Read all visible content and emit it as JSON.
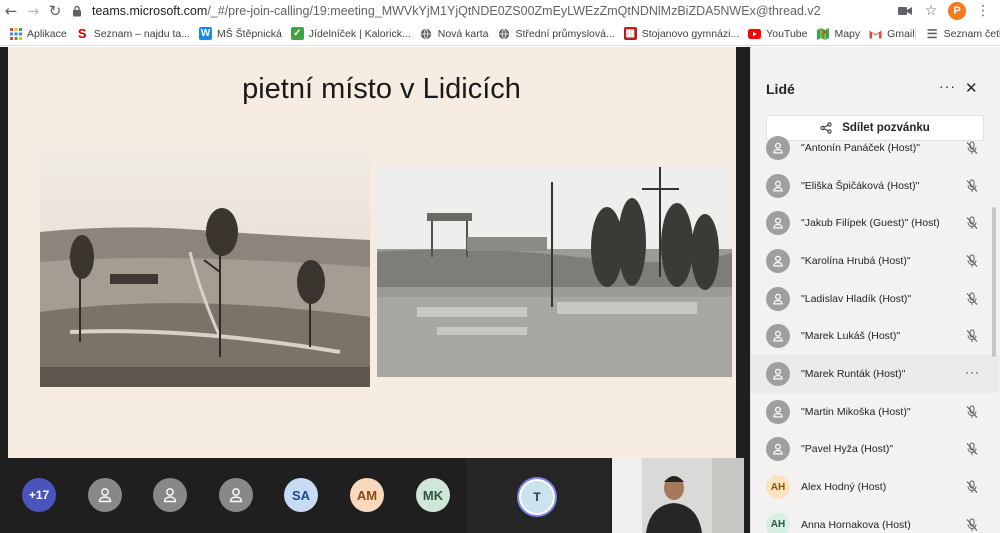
{
  "browser": {
    "url_host": "teams.microsoft.com",
    "url_path": "/_#/pre-join-calling/19:meeting_MWVkYjM1YjQtNDE0ZS00ZmEyLWEzZmQtNDNlMzBiZDA5NWEx@thread.v2",
    "profile_initial": "P",
    "bookmarks": [
      {
        "label": "Aplikace",
        "icon": "apps-grid-icon",
        "color": "#1a73e8"
      },
      {
        "label": "Seznam – najdu ta...",
        "icon": "seznam-icon",
        "color": "#cc0000"
      },
      {
        "label": "MŠ Štěpnická",
        "icon": "w-icon",
        "color": "#1e88e5"
      },
      {
        "label": "Jídelníček | Kalorick...",
        "icon": "check-icon",
        "color": "#43a047"
      },
      {
        "label": "Nová karta",
        "icon": "globe-icon",
        "color": "#5f6368"
      },
      {
        "label": "Střední průmyslová...",
        "icon": "globe-icon",
        "color": "#5f6368"
      },
      {
        "label": "Stojanovo gymnázi...",
        "icon": "school-icon",
        "color": "#d32f2f"
      },
      {
        "label": "YouTube",
        "icon": "youtube-icon",
        "color": "#ff0000"
      },
      {
        "label": "Mapy",
        "icon": "maps-icon",
        "color": "#34a853"
      },
      {
        "label": "Gmail",
        "icon": "gmail-icon",
        "color": "#ea4335"
      }
    ],
    "reading_list": "Seznam četby"
  },
  "slide": {
    "title": "pietní místo v Lidicích"
  },
  "strip": {
    "more_count": "+17",
    "initials": [
      "SA",
      "AM",
      "MK"
    ],
    "active_initial": "T"
  },
  "panel": {
    "title": "Lidé",
    "more": "···",
    "share_label": "Sdílet pozvánku",
    "participants": [
      {
        "name": "\"Antonín Panáček (Host)\"",
        "avatar": "person",
        "state": "muted"
      },
      {
        "name": "\"Eliška Špičáková (Host)\"",
        "avatar": "person",
        "state": "muted"
      },
      {
        "name": "\"Jakub Filípek (Guest)\" (Host)",
        "avatar": "person",
        "state": "muted"
      },
      {
        "name": "\"Karolína Hrubá (Host)\"",
        "avatar": "person",
        "state": "muted"
      },
      {
        "name": "\"Ladislav Hladík (Host)\"",
        "avatar": "person",
        "state": "muted"
      },
      {
        "name": "\"Marek Lukáš (Host)\"",
        "avatar": "person",
        "state": "muted"
      },
      {
        "name": "\"Marek Runták (Host)\"",
        "avatar": "person",
        "state": "hover"
      },
      {
        "name": "\"Martin Mikoška (Host)\"",
        "avatar": "person",
        "state": "muted"
      },
      {
        "name": "\"Pavel Hyža (Host)\"",
        "avatar": "person",
        "state": "muted"
      },
      {
        "name": "Alex Hodný (Host)",
        "avatar": "AH",
        "state": "muted"
      },
      {
        "name": "Anna Hornakova (Host)",
        "avatar": "AH",
        "state": "muted"
      }
    ]
  },
  "colors": {
    "teams_purple": "#4b53bc",
    "slide_bg": "#f6ece1",
    "dark_bg": "#1f1f1f",
    "panel_bg": "#f3f2f1"
  }
}
